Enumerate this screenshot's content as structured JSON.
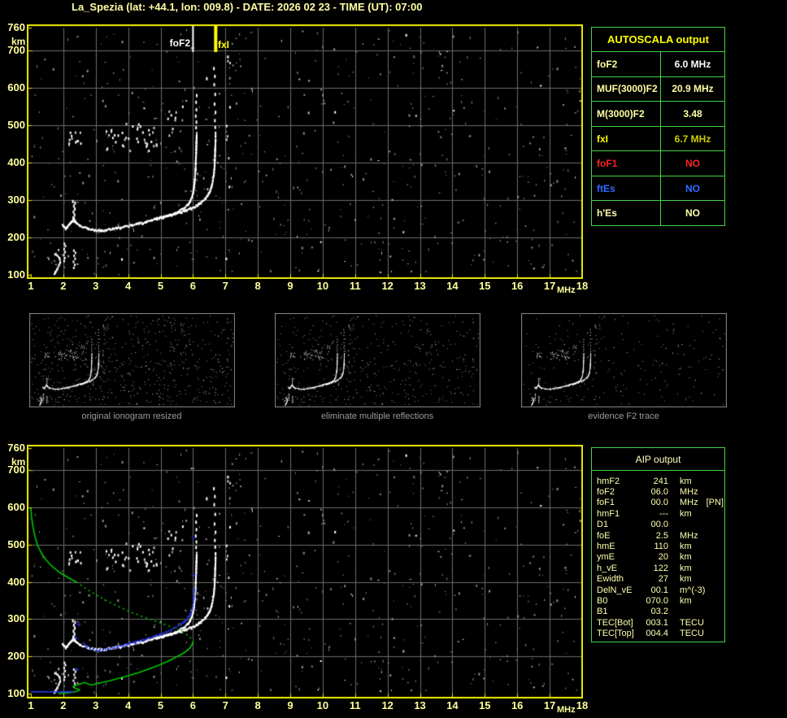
{
  "title": "La_Spezia (lat: +44.1, lon: 009.8) - DATE: 2026 02 23 - TIME (UT): 07:00",
  "colors": {
    "background": "#000000",
    "plot_border": "#ecec00",
    "grid": "#6b6b6b",
    "axis_text": "#ffff9c",
    "trace": "#ffffff",
    "profile_green": "#00c400",
    "restored_blue": "#2a39ee",
    "table_border": "#44d344",
    "caption_gray": "#9c9c9c",
    "title_yellow": "#ffffa6"
  },
  "axes": {
    "freq_ticks": [
      "1",
      "2",
      "3",
      "4",
      "5",
      "6",
      "7",
      "8",
      "9",
      "10",
      "11",
      "12",
      "13",
      "14",
      "15",
      "16",
      "17",
      "18"
    ],
    "freq_unit": "MHz",
    "height_ticks": [
      "760",
      "700",
      "600",
      "500",
      "400",
      "300",
      "200",
      "100"
    ],
    "height_values": [
      760,
      700,
      600,
      500,
      400,
      300,
      200,
      100
    ],
    "height_unit": "km"
  },
  "markers": {
    "foF2_label": "foF2",
    "foF2_freq": 6.0,
    "fxI_label": "fxI",
    "fxI_freq": 6.7
  },
  "autoscala": {
    "header": "AUTOSCALA output",
    "rows": [
      {
        "label": "foF2",
        "value": "6.0 MHz",
        "label_color": "#ffffa4",
        "value_color": "#ffffff"
      },
      {
        "label": "MUF(3000)F2",
        "value": "20.9 MHz",
        "label_color": "#ffffa4",
        "value_color": "#ffffa4"
      },
      {
        "label": "M(3000)F2",
        "value": "3.48",
        "label_color": "#ffffa4",
        "value_color": "#ffffa4"
      },
      {
        "label": "fxI",
        "value": "6.7 MHz",
        "label_color": "#ffff00",
        "value_color": "#cfcf00"
      },
      {
        "label": "foF1",
        "value": "NO",
        "label_color": "#ff2222",
        "value_color": "#ff2222"
      },
      {
        "label": "ftEs",
        "value": "NO",
        "label_color": "#2f6bff",
        "value_color": "#2f6bff"
      },
      {
        "label": "h'Es",
        "value": "NO",
        "label_color": "#ffffa4",
        "value_color": "#ffffa4"
      }
    ]
  },
  "aip": {
    "header": "AIP output",
    "rows": [
      {
        "label": "hmF2",
        "value": "241",
        "unit": "km",
        "note": ""
      },
      {
        "label": "foF2",
        "value": "06.0",
        "unit": "MHz",
        "note": ""
      },
      {
        "label": "foF1",
        "value": "00.0",
        "unit": "MHz",
        "note": "[PN]"
      },
      {
        "label": "hmF1",
        "value": "---",
        "unit": "km",
        "note": ""
      },
      {
        "label": "D1",
        "value": "00.0",
        "unit": "",
        "note": ""
      },
      {
        "label": "foE",
        "value": "2.5",
        "unit": "MHz",
        "note": ""
      },
      {
        "label": "hmE",
        "value": "110",
        "unit": "km",
        "note": ""
      },
      {
        "label": "ymE",
        "value": "20",
        "unit": "km",
        "note": ""
      },
      {
        "label": "h_vE",
        "value": "122",
        "unit": "km",
        "note": ""
      },
      {
        "label": "Ewidth",
        "value": "27",
        "unit": "km",
        "note": ""
      },
      {
        "label": "DelN_vE",
        "value": "00.1",
        "unit": "m^(-3)",
        "note": ""
      },
      {
        "label": "B0",
        "value": "070.0",
        "unit": "km",
        "note": ""
      },
      {
        "label": "B1",
        "value": "03.2",
        "unit": "",
        "note": ""
      },
      {
        "label": "TEC[Bot]",
        "value": "003.1",
        "unit": "TECU",
        "note": ""
      },
      {
        "label": "TEC[Top]",
        "value": "004.4",
        "unit": "TECU",
        "note": ""
      }
    ]
  },
  "thumbnails": [
    {
      "caption": "original ionogram resized"
    },
    {
      "caption": "eliminate multiple reflections"
    },
    {
      "caption": "evidence F2 trace"
    }
  ],
  "chart_data": {
    "type": "scatter",
    "title": "Ionogram La_Spezia 2026-02-23 07:00 UT",
    "xlabel": "frequency (MHz)",
    "ylabel": "virtual height (km)",
    "xlim": [
      1,
      18
    ],
    "ylim": [
      100,
      760
    ],
    "grid": true,
    "o_trace": [
      [
        1.95,
        236
      ],
      [
        2.0,
        230
      ],
      [
        2.05,
        226
      ],
      [
        2.1,
        230
      ],
      [
        2.15,
        236
      ],
      [
        2.2,
        241
      ],
      [
        2.25,
        247
      ],
      [
        2.3,
        252
      ],
      [
        2.35,
        245
      ],
      [
        2.4,
        238
      ],
      [
        2.5,
        232
      ],
      [
        2.6,
        229
      ],
      [
        2.72,
        226
      ],
      [
        2.85,
        223
      ],
      [
        3.0,
        221
      ],
      [
        3.15,
        220
      ],
      [
        3.3,
        222
      ],
      [
        3.5,
        225
      ],
      [
        3.7,
        228
      ],
      [
        3.9,
        231
      ],
      [
        4.1,
        235
      ],
      [
        4.3,
        239
      ],
      [
        4.5,
        243
      ],
      [
        4.7,
        247
      ],
      [
        4.9,
        252
      ],
      [
        5.1,
        257
      ],
      [
        5.25,
        261
      ],
      [
        5.4,
        266
      ],
      [
        5.55,
        272
      ],
      [
        5.7,
        280
      ],
      [
        5.8,
        288
      ],
      [
        5.88,
        297
      ],
      [
        5.94,
        308
      ],
      [
        5.98,
        322
      ],
      [
        6.01,
        338
      ],
      [
        6.03,
        356
      ],
      [
        6.05,
        378
      ],
      [
        6.06,
        400
      ],
      [
        6.07,
        425
      ],
      [
        6.08,
        452
      ],
      [
        6.09,
        480
      ]
    ],
    "o_trace_sparse": [
      [
        6.07,
        497
      ],
      [
        6.08,
        512
      ],
      [
        6.06,
        528
      ],
      [
        6.08,
        545
      ],
      [
        6.07,
        565
      ],
      [
        6.09,
        583
      ]
    ],
    "x_trace": [
      [
        4.8,
        252
      ],
      [
        5.0,
        256
      ],
      [
        5.2,
        260
      ],
      [
        5.4,
        264
      ],
      [
        5.6,
        269
      ],
      [
        5.75,
        274
      ],
      [
        5.9,
        279
      ],
      [
        6.05,
        285
      ],
      [
        6.15,
        291
      ],
      [
        6.25,
        297
      ],
      [
        6.35,
        305
      ],
      [
        6.43,
        314
      ],
      [
        6.5,
        325
      ],
      [
        6.55,
        338
      ],
      [
        6.59,
        354
      ],
      [
        6.62,
        372
      ],
      [
        6.64,
        392
      ],
      [
        6.65,
        412
      ],
      [
        6.66,
        436
      ],
      [
        6.67,
        460
      ],
      [
        6.67,
        482
      ]
    ],
    "x_trace_sparse": [
      [
        6.66,
        498
      ],
      [
        6.65,
        516
      ],
      [
        6.67,
        538
      ],
      [
        6.64,
        560
      ],
      [
        6.66,
        586
      ],
      [
        6.63,
        612
      ],
      [
        6.65,
        634
      ],
      [
        6.62,
        655
      ],
      [
        6.4,
        628
      ]
    ],
    "f_spur": [
      [
        2.28,
        256
      ],
      [
        2.32,
        264
      ],
      [
        2.29,
        272
      ],
      [
        2.33,
        280
      ],
      [
        2.3,
        288
      ],
      [
        2.34,
        296
      ],
      [
        2.27,
        300
      ],
      [
        2.31,
        248
      ]
    ],
    "e_echo_blob_a": [
      [
        2.0,
        140
      ],
      [
        2.02,
        148
      ],
      [
        1.99,
        156
      ],
      [
        2.03,
        164
      ],
      [
        2.0,
        172
      ],
      [
        2.04,
        180
      ],
      [
        2.01,
        186
      ]
    ],
    "e_echo_blob_b": [
      [
        2.3,
        122
      ],
      [
        2.33,
        130
      ],
      [
        2.29,
        138
      ],
      [
        2.34,
        146
      ],
      [
        2.31,
        154
      ],
      [
        2.35,
        162
      ],
      [
        2.3,
        168
      ]
    ],
    "e_echo_squiggle": [
      [
        1.7,
        104
      ],
      [
        1.74,
        110
      ],
      [
        1.79,
        118
      ],
      [
        1.84,
        127
      ],
      [
        1.88,
        136
      ],
      [
        1.86,
        146
      ],
      [
        1.79,
        153
      ],
      [
        1.72,
        157
      ]
    ],
    "clusters": [
      {
        "seed": 21,
        "f": [
          3.3,
          4.9
        ],
        "h": [
          430,
          512
        ],
        "count": 40
      },
      {
        "seed": 22,
        "f": [
          2.15,
          2.6
        ],
        "h": [
          448,
          500
        ],
        "count": 12
      },
      {
        "seed": 23,
        "f": [
          5.2,
          5.7
        ],
        "h": [
          470,
          540
        ],
        "count": 8
      },
      {
        "seed": 24,
        "f": [
          7.0,
          7.15
        ],
        "h": [
          280,
          700
        ],
        "count": 10
      }
    ],
    "noise": {
      "seed": 1337,
      "count": 640
    },
    "profile": {
      "hmF2": 241,
      "foF2": 6.0,
      "foE": 2.5,
      "hmE": 110,
      "topside_solid": [
        [
          1.0,
          600
        ],
        [
          1.02,
          575
        ],
        [
          1.06,
          550
        ],
        [
          1.12,
          525
        ],
        [
          1.2,
          500
        ],
        [
          1.32,
          478
        ],
        [
          1.48,
          458
        ],
        [
          1.68,
          440
        ],
        [
          1.9,
          425
        ],
        [
          2.15,
          412
        ],
        [
          2.4,
          400
        ]
      ],
      "topside_dotted": [
        [
          2.4,
          400
        ],
        [
          2.7,
          382
        ],
        [
          3.0,
          366
        ],
        [
          3.3,
          351
        ],
        [
          3.65,
          336
        ],
        [
          4.0,
          322
        ],
        [
          4.35,
          310
        ],
        [
          4.7,
          299
        ],
        [
          5.0,
          290
        ],
        [
          5.3,
          280
        ],
        [
          5.55,
          271
        ],
        [
          5.75,
          262
        ],
        [
          5.88,
          254
        ],
        [
          5.96,
          247
        ],
        [
          6.0,
          241
        ]
      ],
      "bottomside": [
        [
          6.0,
          241
        ],
        [
          5.97,
          232
        ],
        [
          5.9,
          222
        ],
        [
          5.75,
          211
        ],
        [
          5.5,
          199
        ],
        [
          5.2,
          186
        ],
        [
          4.9,
          175
        ],
        [
          4.6,
          165
        ],
        [
          4.3,
          156
        ],
        [
          4.0,
          148
        ],
        [
          3.7,
          141
        ],
        [
          3.4,
          134
        ],
        [
          3.1,
          128
        ],
        [
          2.85,
          123
        ],
        [
          2.65,
          130
        ],
        [
          2.5,
          125
        ],
        [
          2.38,
          122
        ],
        [
          2.32,
          120
        ],
        [
          2.35,
          115
        ],
        [
          2.45,
          112
        ],
        [
          2.5,
          110
        ],
        [
          2.45,
          107
        ],
        [
          2.3,
          104
        ],
        [
          2.1,
          102
        ],
        [
          1.95,
          101
        ],
        [
          1.85,
          100
        ]
      ]
    },
    "restored_trace": {
      "bottom_row": {
        "f_start": 1.0,
        "f_end": 2.32,
        "h": 107
      },
      "plus_marks": [
        [
          2.4,
          166
        ],
        [
          2.38,
          250
        ],
        [
          2.47,
          287
        ],
        [
          5.99,
          520
        ],
        [
          6.0,
          419
        ]
      ],
      "f_trace": [
        [
          2.6,
          238
        ],
        [
          2.65,
          232
        ],
        [
          2.7,
          228
        ],
        [
          2.8,
          224
        ],
        [
          2.9,
          221
        ],
        [
          3.0,
          219
        ],
        [
          3.1,
          219
        ],
        [
          3.2,
          220
        ],
        [
          3.35,
          222
        ],
        [
          3.5,
          225
        ],
        [
          3.65,
          228
        ],
        [
          3.8,
          231
        ],
        [
          4.0,
          236
        ],
        [
          4.2,
          241
        ],
        [
          4.4,
          246
        ],
        [
          4.6,
          251
        ],
        [
          4.8,
          257
        ],
        [
          5.0,
          263
        ],
        [
          5.15,
          268
        ],
        [
          5.3,
          274
        ],
        [
          5.45,
          281
        ],
        [
          5.6,
          289
        ],
        [
          5.72,
          297
        ],
        [
          5.82,
          307
        ],
        [
          5.9,
          318
        ],
        [
          5.95,
          331
        ],
        [
          5.99,
          347
        ],
        [
          6.01,
          365
        ],
        [
          6.02,
          385
        ]
      ]
    }
  }
}
